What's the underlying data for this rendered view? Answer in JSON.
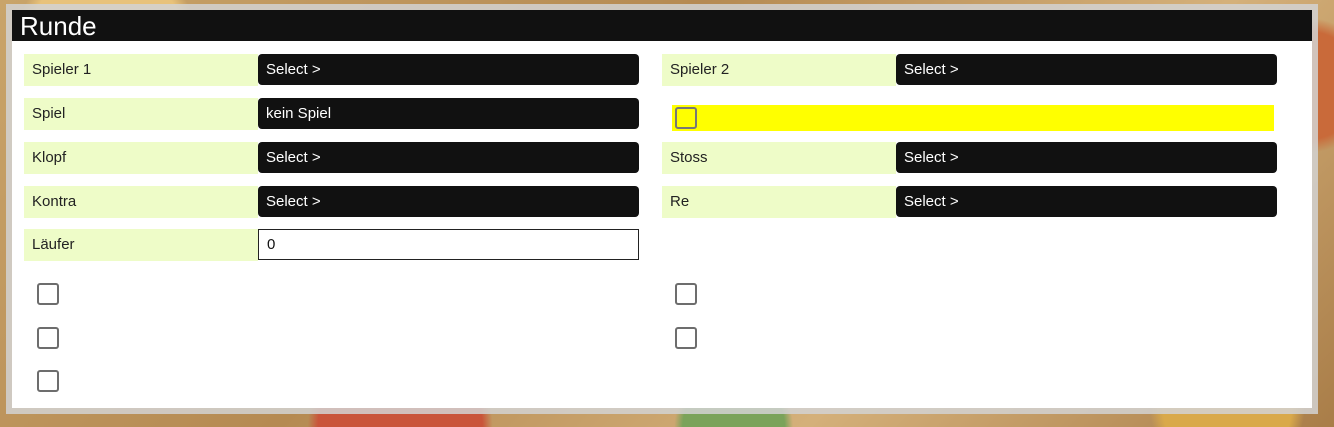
{
  "window": {
    "title": "Runde"
  },
  "left": {
    "spieler1": {
      "label": "Spieler 1",
      "value": "Select >"
    },
    "spiel": {
      "label": "Spiel",
      "value": "kein Spiel"
    },
    "klopf": {
      "label": "Klopf",
      "value": "Select >"
    },
    "kontra": {
      "label": "Kontra",
      "value": "Select >"
    },
    "laeufer": {
      "label": "Läufer",
      "value": "0"
    }
  },
  "right": {
    "spieler2": {
      "label": "Spieler 2",
      "value": "Select >"
    },
    "stoss": {
      "label": "Stoss",
      "value": "Select >"
    },
    "re": {
      "label": "Re",
      "value": "Select >"
    }
  },
  "colors": {
    "label_bg": "#eefcc8",
    "select_bg": "#111111",
    "highlight": "#ffff00",
    "titlebar": "#111111"
  }
}
